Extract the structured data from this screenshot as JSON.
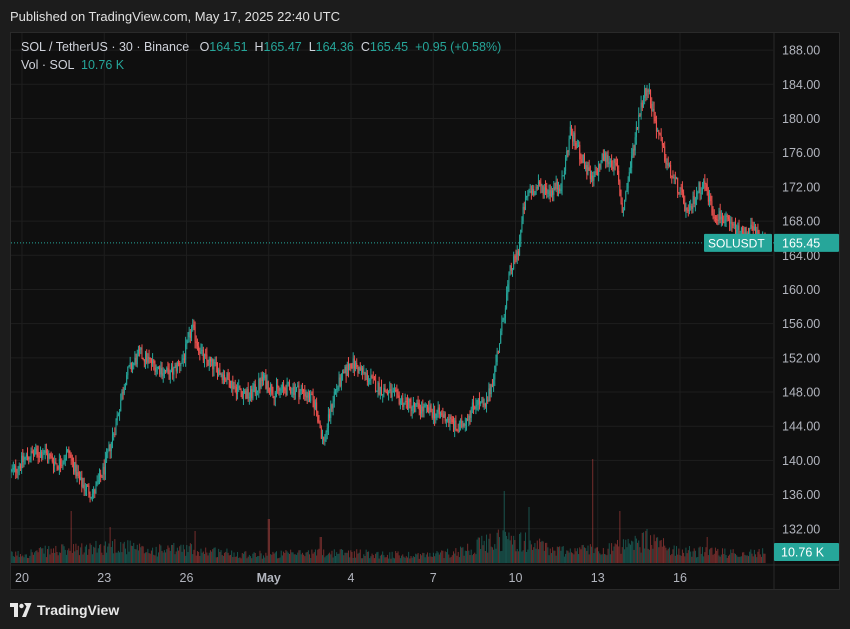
{
  "published": "Published on TradingView.com, May 17, 2025 22:40 UTC",
  "legend": {
    "symbol": "SOL / TetherUS · 30 · Binance",
    "o_label": "O",
    "o_value": "164.51",
    "h_label": "H",
    "h_value": "165.47",
    "l_label": "L",
    "l_value": "164.36",
    "c_label": "C",
    "c_value": "165.45",
    "change": "+0.95 (+0.58%)",
    "vol_label": "Vol · SOL",
    "vol_value": "10.76 K"
  },
  "price_tag": {
    "symbol": "SOLUSDT",
    "value": "165.45"
  },
  "volume_tag": "10.76 K",
  "footer": {
    "brand": "TradingView"
  },
  "colors": {
    "up": "#26a69a",
    "down": "#ef5350",
    "background": "#0f0f0f",
    "grid": "#1e1e1e"
  },
  "chart_data": {
    "type": "candlestick",
    "interval": "30",
    "ylim": [
      128,
      190
    ],
    "y_ticks": [
      "188.00",
      "184.00",
      "180.00",
      "176.00",
      "172.00",
      "168.00",
      "164.00",
      "160.00",
      "156.00",
      "152.00",
      "148.00",
      "144.00",
      "140.00",
      "136.00",
      "132.00"
    ],
    "x_ticks": [
      "20",
      "23",
      "26",
      "May",
      "4",
      "7",
      "10",
      "13",
      "16"
    ],
    "x_tick_positions_day": [
      2,
      5,
      8,
      11,
      14,
      17,
      20,
      23,
      26
    ],
    "x_range_day": [
      1.6,
      29.1
    ],
    "last_price": 165.45,
    "price_path": [
      [
        1.6,
        138.5
      ],
      [
        1.9,
        139.5
      ],
      [
        2.2,
        140.5
      ],
      [
        2.8,
        141.0
      ],
      [
        3.3,
        139.5
      ],
      [
        3.7,
        141.0
      ],
      [
        4.1,
        137.5
      ],
      [
        4.6,
        136.0
      ],
      [
        5.0,
        139.0
      ],
      [
        5.4,
        144.0
      ],
      [
        5.8,
        150.0
      ],
      [
        6.3,
        152.5
      ],
      [
        6.9,
        151.0
      ],
      [
        7.4,
        150.0
      ],
      [
        7.9,
        152.0
      ],
      [
        8.2,
        155.5
      ],
      [
        8.6,
        152.0
      ],
      [
        9.2,
        150.5
      ],
      [
        9.8,
        148.5
      ],
      [
        10.3,
        147.5
      ],
      [
        10.8,
        149.5
      ],
      [
        11.2,
        148.0
      ],
      [
        11.8,
        148.5
      ],
      [
        12.3,
        148.0
      ],
      [
        12.7,
        146.5
      ],
      [
        13.0,
        142.0
      ],
      [
        13.4,
        148.0
      ],
      [
        14.0,
        151.5
      ],
      [
        14.5,
        150.0
      ],
      [
        15.0,
        148.5
      ],
      [
        15.6,
        147.5
      ],
      [
        16.1,
        146.5
      ],
      [
        16.6,
        146.0
      ],
      [
        17.1,
        145.5
      ],
      [
        17.5,
        145.0
      ],
      [
        17.9,
        143.5
      ],
      [
        18.3,
        145.5
      ],
      [
        18.6,
        147.0
      ],
      [
        18.9,
        146.0
      ],
      [
        19.2,
        150.0
      ],
      [
        19.5,
        155.5
      ],
      [
        19.8,
        162.0
      ],
      [
        20.1,
        164.5
      ],
      [
        20.3,
        169.5
      ],
      [
        20.5,
        171.5
      ],
      [
        20.9,
        172.0
      ],
      [
        21.3,
        171.5
      ],
      [
        21.7,
        172.5
      ],
      [
        22.0,
        178.5
      ],
      [
        22.4,
        175.5
      ],
      [
        22.8,
        172.5
      ],
      [
        23.2,
        175.5
      ],
      [
        23.5,
        175.0
      ],
      [
        23.7,
        174.0
      ],
      [
        23.9,
        169.0
      ],
      [
        24.2,
        174.5
      ],
      [
        24.5,
        180.5
      ],
      [
        24.8,
        184.0
      ],
      [
        25.0,
        181.0
      ],
      [
        25.3,
        177.0
      ],
      [
        25.6,
        174.0
      ],
      [
        26.0,
        171.5
      ],
      [
        26.3,
        168.5
      ],
      [
        26.6,
        171.5
      ],
      [
        26.9,
        172.5
      ],
      [
        27.2,
        169.0
      ],
      [
        27.5,
        168.5
      ],
      [
        27.8,
        167.5
      ],
      [
        28.2,
        166.5
      ],
      [
        28.6,
        167.0
      ],
      [
        29.1,
        165.45
      ]
    ],
    "volume_profile": [
      [
        1.6,
        4
      ],
      [
        3.0,
        6
      ],
      [
        4.5,
        7
      ],
      [
        5.5,
        9
      ],
      [
        6.5,
        6
      ],
      [
        8.0,
        7
      ],
      [
        9.5,
        5
      ],
      [
        11.0,
        4
      ],
      [
        12.5,
        5
      ],
      [
        14.0,
        5
      ],
      [
        15.5,
        4
      ],
      [
        17.0,
        4
      ],
      [
        18.0,
        6
      ],
      [
        19.5,
        12
      ],
      [
        20.5,
        10
      ],
      [
        21.5,
        6
      ],
      [
        23.0,
        7
      ],
      [
        24.0,
        8
      ],
      [
        24.8,
        11
      ],
      [
        26.0,
        6
      ],
      [
        27.5,
        5
      ],
      [
        29.1,
        5
      ]
    ],
    "volume_spikes": [
      [
        3.8,
        26
      ],
      [
        5.2,
        18
      ],
      [
        8.3,
        16
      ],
      [
        11.0,
        22
      ],
      [
        12.9,
        13
      ],
      [
        19.6,
        36
      ],
      [
        20.5,
        28
      ],
      [
        22.8,
        52
      ],
      [
        23.8,
        26
      ],
      [
        24.8,
        17
      ],
      [
        27.0,
        13
      ]
    ]
  }
}
